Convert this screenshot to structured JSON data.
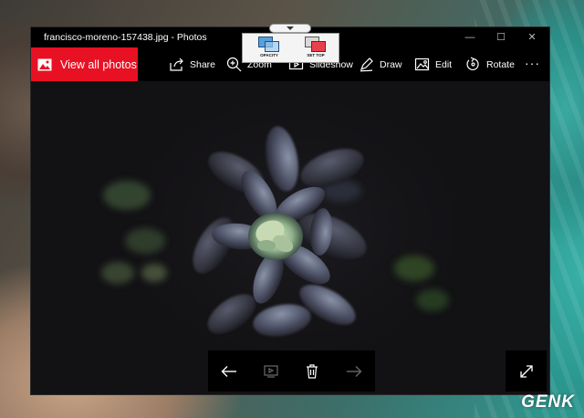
{
  "window": {
    "title": "francisco-moreno-157438.jpg - Photos",
    "controls": {
      "minimize": "—",
      "maximize": "☐",
      "close": "✕"
    }
  },
  "toolbar": {
    "view_all_label": "View all photos",
    "share_label": "Share",
    "zoom_label": "Zoom",
    "slideshow_label": "Slideshow",
    "draw_label": "Draw",
    "edit_label": "Edit",
    "rotate_label": "Rotate",
    "more_label": "···",
    "accent": "#e81123"
  },
  "overlay_tool": {
    "opacity_label": "OPACITY",
    "set_top_label": "SET TOP"
  },
  "bottom_nav": {
    "icons": [
      "back-arrow-icon",
      "slideshow-icon",
      "delete-icon",
      "forward-arrow-icon",
      "fullscreen-icon"
    ]
  },
  "watermark": "GENK"
}
